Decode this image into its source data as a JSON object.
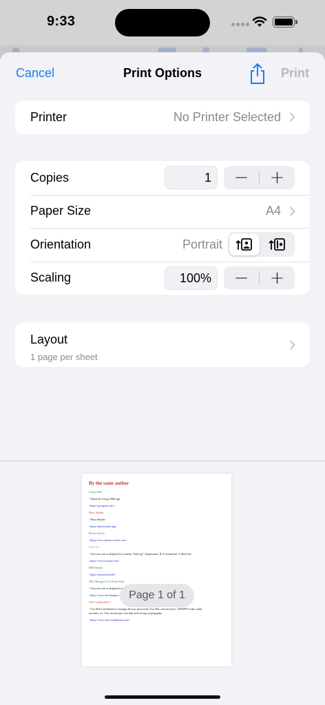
{
  "status": {
    "time": "9:33"
  },
  "nav": {
    "cancel": "Cancel",
    "title": "Print Options",
    "print": "Print"
  },
  "printer": {
    "label": "Printer",
    "value": "No Printer Selected"
  },
  "settings": {
    "copies": {
      "label": "Copies",
      "value": "1",
      "minus": "−",
      "plus": "+"
    },
    "paper_size": {
      "label": "Paper Size",
      "value": "A4"
    },
    "orientation": {
      "label": "Orientation",
      "value": "Portrait"
    },
    "scaling": {
      "label": "Scaling",
      "value": "100%",
      "minus": "−",
      "plus": "+"
    }
  },
  "layout": {
    "label": "Layout",
    "sub": "1 page per sheet"
  },
  "preview": {
    "page_indicator": "Page 1 of 1",
    "doc_title": "By the same author",
    "entries": [
      {
        "heading": "Group SMS",
        "heading_color": "#2e9c45",
        "lines": [
          "- About the Group SMS app"
        ],
        "link": "<https://groupsms.info>"
      },
      {
        "heading": "Photo Reader",
        "heading_color": "#d9433a",
        "lines": [
          "- Photo Reader"
        ],
        "link": "<https://photoreader.app>"
      },
      {
        "heading": "Photos Search",
        "heading_color": "#a340b8",
        "lines": [],
        "link": "<https://www.photos-search.com>"
      },
      {
        "heading": "SMS Star",
        "heading_color": "#d9a233",
        "lines": [
          "- Your new text is displayed in a handy \"help tag\". Ampersand : & A second line. A third line."
        ],
        "link": "<https://www.smsstar.com>"
      },
      {
        "heading": "SMS Search",
        "heading_color": "#3556c8",
        "lines": [],
        "link": "<https://smssearch.info>"
      },
      {
        "heading": "URL Manager Pro's Home Page",
        "heading_color": "#2e9c45",
        "lines": [
          "- Your new text is displayed in a handy \"help tag\". A second line. A third line. Fourth."
        ],
        "link": "<https://www.url-manager.com>"
      },
      {
        "heading": "Web Confidential™",
        "heading_color": "#d9433a",
        "lines": [
          "- Use Web Confidential to manage all your passwords, User IDs, software keys, ATM/PIN codes, bank",
          "accounts, etc. You can encrypt your data with strong cryptography."
        ],
        "link": "<https://www.web-confidential.com>"
      }
    ]
  }
}
